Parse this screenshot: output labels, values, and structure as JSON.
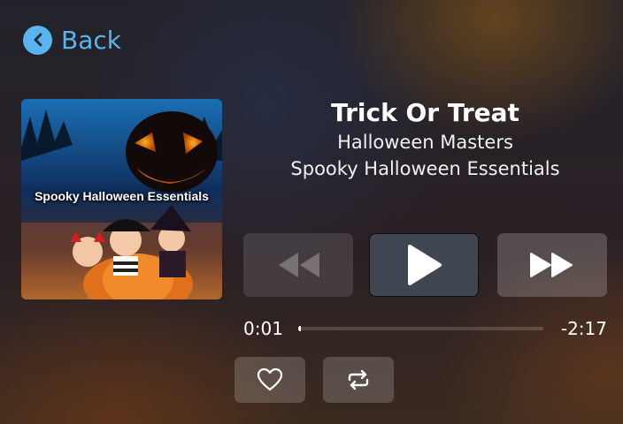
{
  "nav": {
    "back_label": "Back"
  },
  "album_art": {
    "title": "Spooky Halloween Essentials"
  },
  "now_playing": {
    "title": "Trick Or Treat",
    "artist": "Halloween Masters",
    "album": "Spooky Halloween Essentials"
  },
  "playback": {
    "elapsed": "0:01",
    "remaining": "-2:17",
    "progress_fraction": 0.007,
    "state": "paused"
  },
  "icons": {
    "back": "chevron-left-icon",
    "previous": "rewind-icon",
    "play": "play-icon",
    "next": "fast-forward-icon",
    "love": "heart-icon",
    "repeat": "repeat-icon"
  },
  "colors": {
    "accent": "#5ab4f0",
    "play_button": "#3f4652"
  }
}
